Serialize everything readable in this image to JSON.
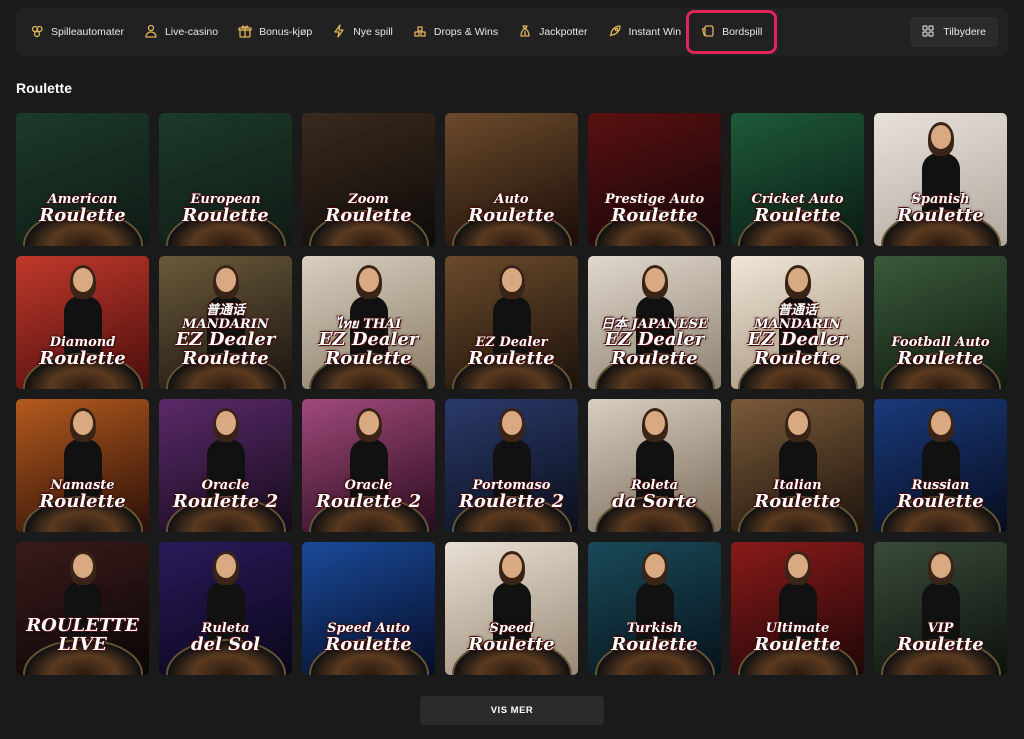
{
  "nav": {
    "items": [
      {
        "label": "Spilleautomater",
        "icon": "slots-icon",
        "active": false
      },
      {
        "label": "Live-casino",
        "icon": "live-dealer-icon",
        "active": false
      },
      {
        "label": "Bonus-kjøp",
        "icon": "gift-box-icon",
        "active": false
      },
      {
        "label": "Nye spill",
        "icon": "lightning-icon",
        "active": false
      },
      {
        "label": "Drops & Wins",
        "icon": "drops-icon",
        "active": false
      },
      {
        "label": "Jackpotter",
        "icon": "money-bag-icon",
        "active": false
      },
      {
        "label": "Instant Win",
        "icon": "rocket-icon",
        "active": false
      },
      {
        "label": "Bordspill",
        "icon": "cards-icon",
        "active": true
      }
    ],
    "providers_label": "Tilbydere",
    "accent": "#e2245b"
  },
  "section": {
    "title": "Roulette"
  },
  "games": [
    {
      "l1": "American",
      "l2": "Roulette",
      "bg": [
        "#1d3a2c",
        "#0f1a14"
      ],
      "dealer": false
    },
    {
      "l1": "European",
      "l2": "Roulette",
      "bg": [
        "#1d3a2c",
        "#0f1a14"
      ],
      "dealer": false
    },
    {
      "l1": "Zoom",
      "l2": "Roulette",
      "bg": [
        "#3a2a1e",
        "#0c0a08"
      ],
      "dealer": false
    },
    {
      "l1": "Auto",
      "l2": "Roulette",
      "bg": [
        "#6b4a2c",
        "#1a0d07"
      ],
      "dealer": false
    },
    {
      "l1": "Prestige Auto",
      "l2": "Roulette",
      "bg": [
        "#5a1010",
        "#12060a"
      ],
      "dealer": false
    },
    {
      "l1": "Cricket Auto",
      "l2": "Roulette",
      "bg": [
        "#1e5a3a",
        "#0b1a12"
      ],
      "dealer": false
    },
    {
      "l1": "Spanish",
      "l2": "Roulette",
      "bg": [
        "#e8e2dc",
        "#b2a79e"
      ],
      "dealer": true
    },
    {
      "l1": "Diamond",
      "l2": "Roulette",
      "bg": [
        "#c0392b",
        "#4a0d0d"
      ],
      "dealer": true
    },
    {
      "l1": "普通话 MANDARIN",
      "l2": "EZ Dealer Roulette",
      "bg": [
        "#6a5a3a",
        "#1a1410"
      ],
      "dealer": true
    },
    {
      "l1": "ไทย THAI",
      "l2": "EZ Dealer Roulette",
      "bg": [
        "#d8cfbf",
        "#8a7a66"
      ],
      "dealer": true
    },
    {
      "l1": "EZ Dealer",
      "l2": "Roulette",
      "bg": [
        "#6a4a2c",
        "#1c120a"
      ],
      "dealer": true
    },
    {
      "l1": "日本 JAPANESE",
      "l2": "EZ Dealer Roulette",
      "bg": [
        "#e0d8cc",
        "#8c8070"
      ],
      "dealer": true
    },
    {
      "l1": "普通话 MANDARIN",
      "l2": "EZ Dealer Roulette",
      "bg": [
        "#f0e6d8",
        "#a08f76"
      ],
      "dealer": true
    },
    {
      "l1": "Football Auto",
      "l2": "Roulette",
      "bg": [
        "#3a5a3a",
        "#0f1a10"
      ],
      "dealer": false
    },
    {
      "l1": "Namaste",
      "l2": "Roulette",
      "bg": [
        "#b45a1e",
        "#2a0f08"
      ],
      "dealer": true
    },
    {
      "l1": "Oracle",
      "l2": "Roulette 2",
      "bg": [
        "#5a2a6a",
        "#140a1a"
      ],
      "dealer": true
    },
    {
      "l1": "Oracle",
      "l2": "Roulette 2",
      "bg": [
        "#a04a7a",
        "#2a0a1e"
      ],
      "dealer": true
    },
    {
      "l1": "Portomaso",
      "l2": "Roulette 2",
      "bg": [
        "#2a3a6a",
        "#0a0e1a"
      ],
      "dealer": true
    },
    {
      "l1": "Roleta",
      "l2": "da Sorte",
      "bg": [
        "#d8cfc0",
        "#7a6a58"
      ],
      "dealer": true
    },
    {
      "l1": "Italian",
      "l2": "Roulette",
      "bg": [
        "#7a5a3a",
        "#1e140c"
      ],
      "dealer": true
    },
    {
      "l1": "Russian",
      "l2": "Roulette",
      "bg": [
        "#1a3a7a",
        "#060c1e"
      ],
      "dealer": true
    },
    {
      "l1": "",
      "l2": "ROULETTE LIVE",
      "bg": [
        "#3a1a1a",
        "#0a0606"
      ],
      "dealer": true
    },
    {
      "l1": "Ruleta",
      "l2": "del Sol",
      "bg": [
        "#2a1a5a",
        "#0a061a"
      ],
      "dealer": true
    },
    {
      "l1": "Speed Auto",
      "l2": "Roulette",
      "bg": [
        "#1a4a9a",
        "#060c24"
      ],
      "dealer": false
    },
    {
      "l1": "Speed",
      "l2": "Roulette",
      "bg": [
        "#e8e0d4",
        "#9a8a76"
      ],
      "dealer": true
    },
    {
      "l1": "Turkish",
      "l2": "Roulette",
      "bg": [
        "#1a4a5a",
        "#06121a"
      ],
      "dealer": true
    },
    {
      "l1": "Ultimate",
      "l2": "Roulette",
      "bg": [
        "#8a1a1a",
        "#1e0606"
      ],
      "dealer": true
    },
    {
      "l1": "VIP",
      "l2": "Roulette",
      "bg": [
        "#3a4a3a",
        "#0c120c"
      ],
      "dealer": true
    }
  ],
  "load_more": {
    "label": "VIS MER"
  }
}
